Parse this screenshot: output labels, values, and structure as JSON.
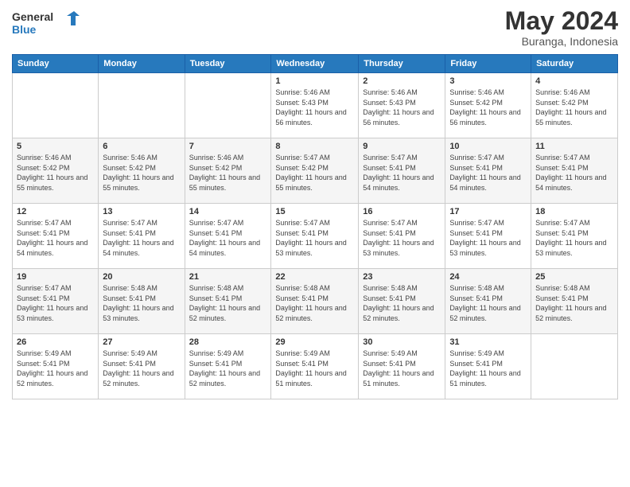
{
  "logo": {
    "text_general": "General",
    "text_blue": "Blue"
  },
  "title": {
    "month": "May 2024",
    "location": "Buranga, Indonesia"
  },
  "days_of_week": [
    "Sunday",
    "Monday",
    "Tuesday",
    "Wednesday",
    "Thursday",
    "Friday",
    "Saturday"
  ],
  "weeks": [
    [
      {
        "day": "",
        "sunrise": "",
        "sunset": "",
        "daylight": ""
      },
      {
        "day": "",
        "sunrise": "",
        "sunset": "",
        "daylight": ""
      },
      {
        "day": "",
        "sunrise": "",
        "sunset": "",
        "daylight": ""
      },
      {
        "day": "1",
        "sunrise": "Sunrise: 5:46 AM",
        "sunset": "Sunset: 5:43 PM",
        "daylight": "Daylight: 11 hours and 56 minutes."
      },
      {
        "day": "2",
        "sunrise": "Sunrise: 5:46 AM",
        "sunset": "Sunset: 5:43 PM",
        "daylight": "Daylight: 11 hours and 56 minutes."
      },
      {
        "day": "3",
        "sunrise": "Sunrise: 5:46 AM",
        "sunset": "Sunset: 5:42 PM",
        "daylight": "Daylight: 11 hours and 56 minutes."
      },
      {
        "day": "4",
        "sunrise": "Sunrise: 5:46 AM",
        "sunset": "Sunset: 5:42 PM",
        "daylight": "Daylight: 11 hours and 55 minutes."
      }
    ],
    [
      {
        "day": "5",
        "sunrise": "Sunrise: 5:46 AM",
        "sunset": "Sunset: 5:42 PM",
        "daylight": "Daylight: 11 hours and 55 minutes."
      },
      {
        "day": "6",
        "sunrise": "Sunrise: 5:46 AM",
        "sunset": "Sunset: 5:42 PM",
        "daylight": "Daylight: 11 hours and 55 minutes."
      },
      {
        "day": "7",
        "sunrise": "Sunrise: 5:46 AM",
        "sunset": "Sunset: 5:42 PM",
        "daylight": "Daylight: 11 hours and 55 minutes."
      },
      {
        "day": "8",
        "sunrise": "Sunrise: 5:47 AM",
        "sunset": "Sunset: 5:42 PM",
        "daylight": "Daylight: 11 hours and 55 minutes."
      },
      {
        "day": "9",
        "sunrise": "Sunrise: 5:47 AM",
        "sunset": "Sunset: 5:41 PM",
        "daylight": "Daylight: 11 hours and 54 minutes."
      },
      {
        "day": "10",
        "sunrise": "Sunrise: 5:47 AM",
        "sunset": "Sunset: 5:41 PM",
        "daylight": "Daylight: 11 hours and 54 minutes."
      },
      {
        "day": "11",
        "sunrise": "Sunrise: 5:47 AM",
        "sunset": "Sunset: 5:41 PM",
        "daylight": "Daylight: 11 hours and 54 minutes."
      }
    ],
    [
      {
        "day": "12",
        "sunrise": "Sunrise: 5:47 AM",
        "sunset": "Sunset: 5:41 PM",
        "daylight": "Daylight: 11 hours and 54 minutes."
      },
      {
        "day": "13",
        "sunrise": "Sunrise: 5:47 AM",
        "sunset": "Sunset: 5:41 PM",
        "daylight": "Daylight: 11 hours and 54 minutes."
      },
      {
        "day": "14",
        "sunrise": "Sunrise: 5:47 AM",
        "sunset": "Sunset: 5:41 PM",
        "daylight": "Daylight: 11 hours and 54 minutes."
      },
      {
        "day": "15",
        "sunrise": "Sunrise: 5:47 AM",
        "sunset": "Sunset: 5:41 PM",
        "daylight": "Daylight: 11 hours and 53 minutes."
      },
      {
        "day": "16",
        "sunrise": "Sunrise: 5:47 AM",
        "sunset": "Sunset: 5:41 PM",
        "daylight": "Daylight: 11 hours and 53 minutes."
      },
      {
        "day": "17",
        "sunrise": "Sunrise: 5:47 AM",
        "sunset": "Sunset: 5:41 PM",
        "daylight": "Daylight: 11 hours and 53 minutes."
      },
      {
        "day": "18",
        "sunrise": "Sunrise: 5:47 AM",
        "sunset": "Sunset: 5:41 PM",
        "daylight": "Daylight: 11 hours and 53 minutes."
      }
    ],
    [
      {
        "day": "19",
        "sunrise": "Sunrise: 5:47 AM",
        "sunset": "Sunset: 5:41 PM",
        "daylight": "Daylight: 11 hours and 53 minutes."
      },
      {
        "day": "20",
        "sunrise": "Sunrise: 5:48 AM",
        "sunset": "Sunset: 5:41 PM",
        "daylight": "Daylight: 11 hours and 53 minutes."
      },
      {
        "day": "21",
        "sunrise": "Sunrise: 5:48 AM",
        "sunset": "Sunset: 5:41 PM",
        "daylight": "Daylight: 11 hours and 52 minutes."
      },
      {
        "day": "22",
        "sunrise": "Sunrise: 5:48 AM",
        "sunset": "Sunset: 5:41 PM",
        "daylight": "Daylight: 11 hours and 52 minutes."
      },
      {
        "day": "23",
        "sunrise": "Sunrise: 5:48 AM",
        "sunset": "Sunset: 5:41 PM",
        "daylight": "Daylight: 11 hours and 52 minutes."
      },
      {
        "day": "24",
        "sunrise": "Sunrise: 5:48 AM",
        "sunset": "Sunset: 5:41 PM",
        "daylight": "Daylight: 11 hours and 52 minutes."
      },
      {
        "day": "25",
        "sunrise": "Sunrise: 5:48 AM",
        "sunset": "Sunset: 5:41 PM",
        "daylight": "Daylight: 11 hours and 52 minutes."
      }
    ],
    [
      {
        "day": "26",
        "sunrise": "Sunrise: 5:49 AM",
        "sunset": "Sunset: 5:41 PM",
        "daylight": "Daylight: 11 hours and 52 minutes."
      },
      {
        "day": "27",
        "sunrise": "Sunrise: 5:49 AM",
        "sunset": "Sunset: 5:41 PM",
        "daylight": "Daylight: 11 hours and 52 minutes."
      },
      {
        "day": "28",
        "sunrise": "Sunrise: 5:49 AM",
        "sunset": "Sunset: 5:41 PM",
        "daylight": "Daylight: 11 hours and 52 minutes."
      },
      {
        "day": "29",
        "sunrise": "Sunrise: 5:49 AM",
        "sunset": "Sunset: 5:41 PM",
        "daylight": "Daylight: 11 hours and 51 minutes."
      },
      {
        "day": "30",
        "sunrise": "Sunrise: 5:49 AM",
        "sunset": "Sunset: 5:41 PM",
        "daylight": "Daylight: 11 hours and 51 minutes."
      },
      {
        "day": "31",
        "sunrise": "Sunrise: 5:49 AM",
        "sunset": "Sunset: 5:41 PM",
        "daylight": "Daylight: 11 hours and 51 minutes."
      },
      {
        "day": "",
        "sunrise": "",
        "sunset": "",
        "daylight": ""
      }
    ]
  ]
}
